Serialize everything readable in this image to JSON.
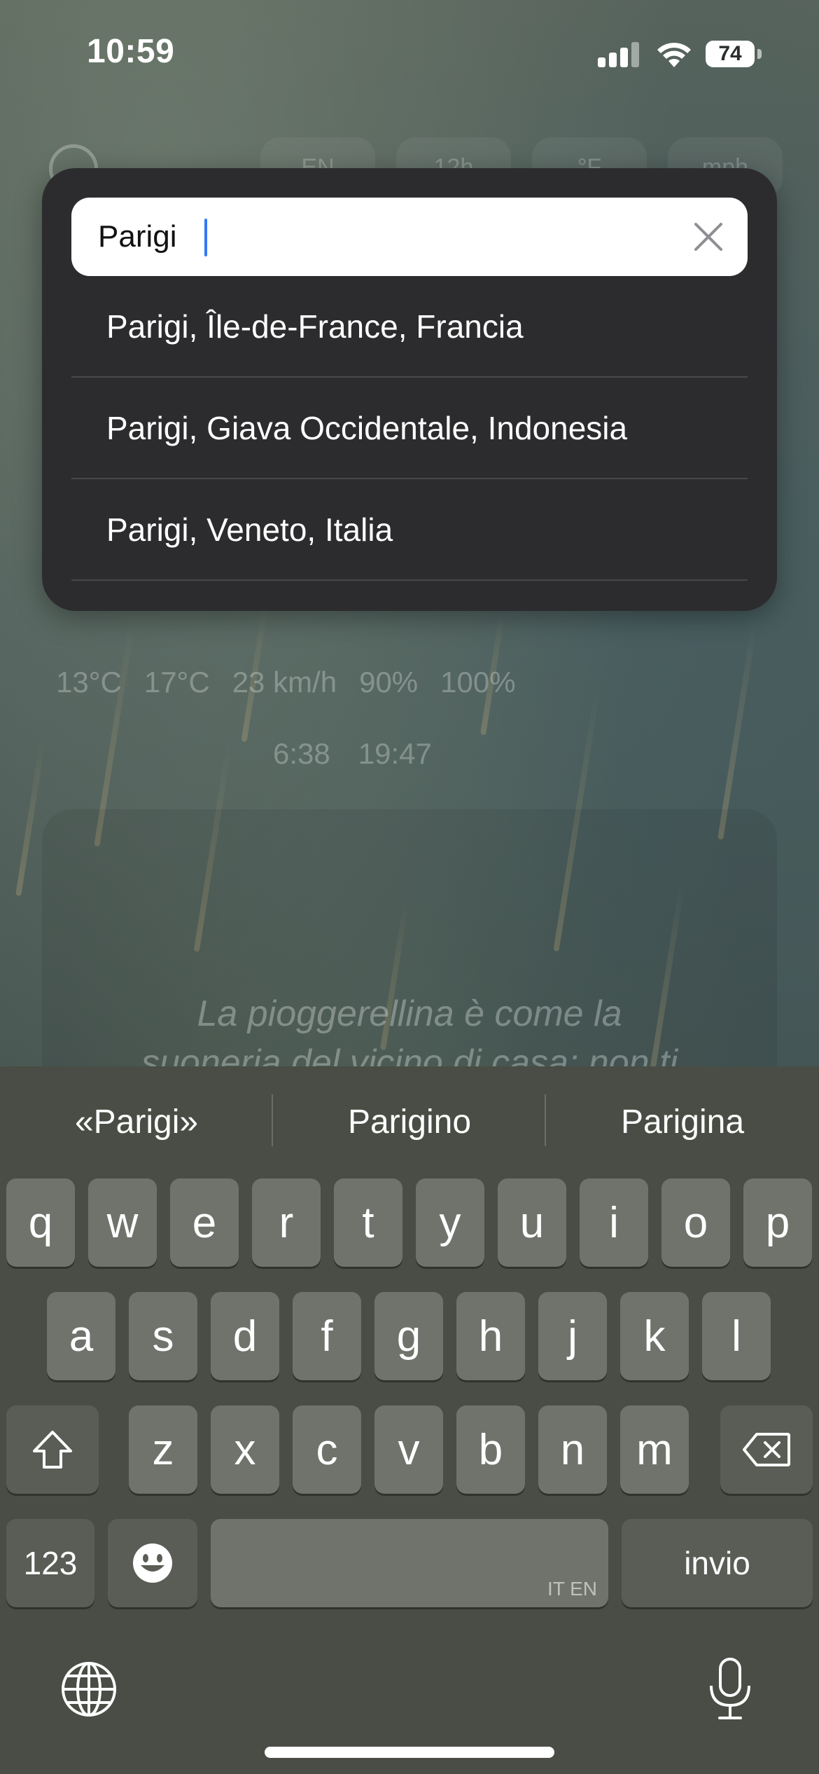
{
  "status_bar": {
    "time": "10:59",
    "battery": "74"
  },
  "background_app": {
    "settings_pills": [
      "EN",
      "12h",
      "°F",
      "mph"
    ],
    "stats": {
      "temp_min": "13°C",
      "temp_max": "17°C",
      "wind": "23 km/h",
      "humidity": "90%",
      "precip": "100%",
      "sunrise": "6:38",
      "sunset": "19:47"
    },
    "quote_line1": "La pioggerellina è come la",
    "quote_line2": "suoneria del vicino di casa: non ti"
  },
  "search": {
    "value": "Parigi",
    "results": [
      "Parigi, Île-de-France, Francia",
      "Parigi, Giava Occidentale, Indonesia",
      "Parigi, Veneto, Italia"
    ]
  },
  "keyboard": {
    "suggestions": [
      "«Parigi»",
      "Parigino",
      "Parigina"
    ],
    "row1": [
      "q",
      "w",
      "e",
      "r",
      "t",
      "y",
      "u",
      "i",
      "o",
      "p"
    ],
    "row2": [
      "a",
      "s",
      "d",
      "f",
      "g",
      "h",
      "j",
      "k",
      "l"
    ],
    "row3": [
      "z",
      "x",
      "c",
      "v",
      "b",
      "n",
      "m"
    ],
    "numbers_label": "123",
    "space_languages": "IT EN",
    "return_label": "invio"
  },
  "icons": [
    "signal-icon",
    "wifi-icon",
    "battery-icon",
    "clear-icon",
    "shift-icon",
    "delete-icon",
    "emoji-icon",
    "globe-icon",
    "microphone-icon"
  ]
}
